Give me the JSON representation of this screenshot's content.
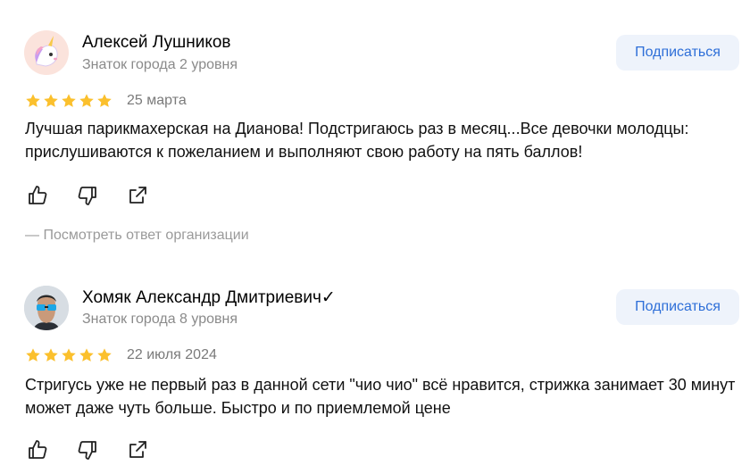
{
  "reviews": [
    {
      "author": "Алексей Лушников",
      "level": "Знаток города 2 уровня",
      "subscribe_label": "Подписаться",
      "rating": 5,
      "date": "25 марта",
      "text": "Лучшая парикмахерская на Дианова! Подстригаюсь раз в месяц...Все девочки молодцы: прислушиваются к пожеланием и выполняют свою работу на пять баллов!",
      "org_reply_label": "— Посмотреть ответ организации",
      "avatar_icon": "unicorn-icon"
    },
    {
      "author": "Хомяк Александр Дмитриевич✓",
      "level": "Знаток города 8 уровня",
      "subscribe_label": "Подписаться",
      "rating": 5,
      "date": "22 июля 2024",
      "text": "Стригусь уже не первый раз в данной сети \"чио чио\" всё нравится, стрижка занимает 30 минут может даже чуть больше. Быстро и по приемлемой цене",
      "avatar_icon": "user-photo-avatar"
    }
  ],
  "colors": {
    "star": "#fbc02d",
    "subscribe_bg": "#eef3fb",
    "subscribe_text": "#2e6fd8",
    "muted": "#8a8a8a"
  }
}
